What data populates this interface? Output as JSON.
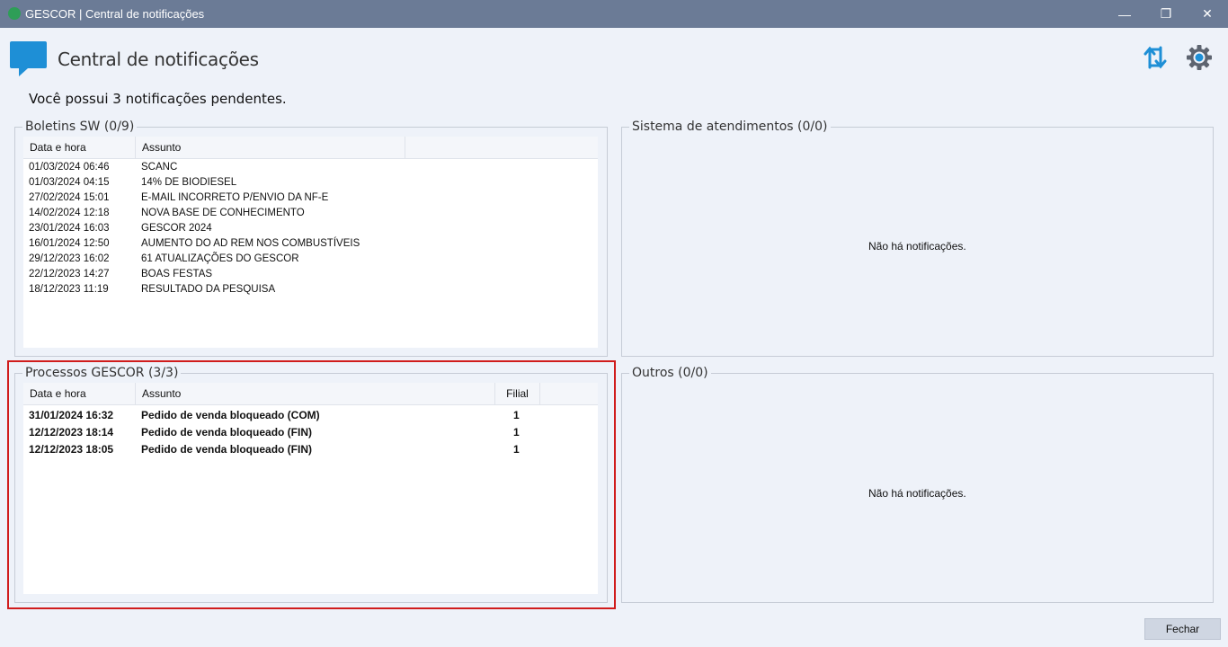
{
  "window": {
    "title": "GESCOR | Central de notificações",
    "minimize_label": "—",
    "restore_label": "❐",
    "close_label": "✕"
  },
  "header": {
    "title": "Central de notificações",
    "refresh_icon": "refresh-arrows-icon",
    "settings_icon": "gear-icon"
  },
  "pending_message": "Você possui 3 notificações pendentes.",
  "boletins": {
    "legend": "Boletins SW (0/9)",
    "columns": [
      "Data e hora",
      "Assunto"
    ],
    "rows": [
      {
        "date": "01/03/2024 06:46",
        "subject": "SCANC"
      },
      {
        "date": "01/03/2024 04:15",
        "subject": "14% DE BIODIESEL"
      },
      {
        "date": "27/02/2024 15:01",
        "subject": "E-MAIL INCORRETO P/ENVIO DA NF-E"
      },
      {
        "date": "14/02/2024 12:18",
        "subject": "NOVA BASE DE CONHECIMENTO"
      },
      {
        "date": "23/01/2024 16:03",
        "subject": "GESCOR 2024"
      },
      {
        "date": "16/01/2024 12:50",
        "subject": "AUMENTO DO AD REM NOS COMBUSTÍVEIS"
      },
      {
        "date": "29/12/2023 16:02",
        "subject": "61 ATUALIZAÇÕES DO GESCOR"
      },
      {
        "date": "22/12/2023 14:27",
        "subject": "BOAS FESTAS"
      },
      {
        "date": "18/12/2023 11:19",
        "subject": "RESULTADO DA PESQUISA"
      }
    ]
  },
  "processos": {
    "legend": "Processos GESCOR (3/3)",
    "columns": [
      "Data e hora",
      "Assunto",
      "Filial"
    ],
    "rows": [
      {
        "date": "31/01/2024 16:32",
        "subject": "Pedido de venda bloqueado (COM)",
        "filial": "1"
      },
      {
        "date": "12/12/2023 18:14",
        "subject": "Pedido de venda bloqueado (FIN)",
        "filial": "1"
      },
      {
        "date": "12/12/2023 18:05",
        "subject": "Pedido de venda bloqueado (FIN)",
        "filial": "1"
      }
    ]
  },
  "atendimentos": {
    "legend": "Sistema de atendimentos (0/0)",
    "empty": "Não há notificações."
  },
  "outros": {
    "legend": "Outros (0/0)",
    "empty": "Não há notificações."
  },
  "footer": {
    "close_label": "Fechar"
  },
  "colors": {
    "titlebar": "#6b7b96",
    "background": "#eef2f9",
    "accent_blue": "#1e8fd6",
    "highlight_red": "#d01c1c"
  }
}
